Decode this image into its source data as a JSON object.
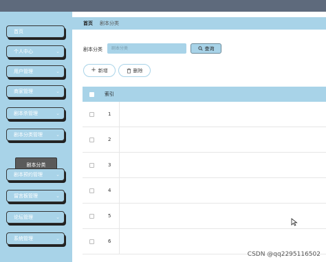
{
  "sidebar": {
    "items": [
      {
        "label": "首页",
        "has_chevron": false
      },
      {
        "label": "个人中心",
        "has_chevron": true
      },
      {
        "label": "用户管理",
        "has_chevron": true
      },
      {
        "label": "商家管理",
        "has_chevron": true
      },
      {
        "label": "剧本杀管理",
        "has_chevron": true
      },
      {
        "label": "剧本分类管理",
        "has_chevron": true
      },
      {
        "label": "剧本预约管理",
        "has_chevron": true
      },
      {
        "label": "留言板管理",
        "has_chevron": true
      },
      {
        "label": "论坛管理",
        "has_chevron": true
      },
      {
        "label": "系统管理",
        "has_chevron": true
      }
    ],
    "active_submenu": {
      "label": "剧本分类"
    }
  },
  "breadcrumb": {
    "home": "首页",
    "current": "剧本分类"
  },
  "search": {
    "label": "剧本分类",
    "placeholder": "剧本分类",
    "value": "",
    "button_label": "查询"
  },
  "actions": {
    "add_label": "新增",
    "delete_label": "删除"
  },
  "table": {
    "columns": [
      "索引"
    ],
    "rows": [
      {
        "index": "1"
      },
      {
        "index": "2"
      },
      {
        "index": "3"
      },
      {
        "index": "4"
      },
      {
        "index": "5"
      },
      {
        "index": "6"
      }
    ]
  },
  "watermark": "CSDN @qq2295116502",
  "colors": {
    "accent": "#a8d3e8",
    "topbar": "#5e6a7c",
    "submenu": "#5a5a5a"
  }
}
